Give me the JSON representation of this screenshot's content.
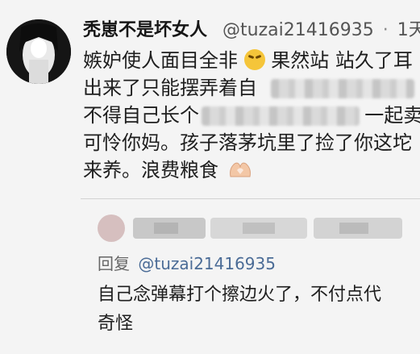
{
  "post": {
    "username": "秃崽不是坏女人",
    "handle": "@tuzai21416935",
    "dot": "·",
    "time": "1天",
    "lines": {
      "l1a": "嫉妒使人面目全非",
      "l1b": "果然站",
      "l1c": "站久了耳",
      "l2a": "出来了只能摆弄着自",
      "l2b": "终",
      "l3a": "不得自己长个",
      "l3b": "一起卖",
      "l4": "可怜你妈。孩子落茅坑里了捡了你这坨",
      "l5": "来养。浪费粮食"
    },
    "emoji_icon": "grinning-squint-face-icon",
    "hands_icon": "heart-hands-icon"
  },
  "reply": {
    "prefix": "回复",
    "mention": "@tuzai21416935",
    "line1": "自己念弹幕打个擦边火了，不付点代",
    "line2": "奇怪"
  },
  "colors": {
    "background": "#f4f4f4",
    "mention": "#4a6b96"
  }
}
